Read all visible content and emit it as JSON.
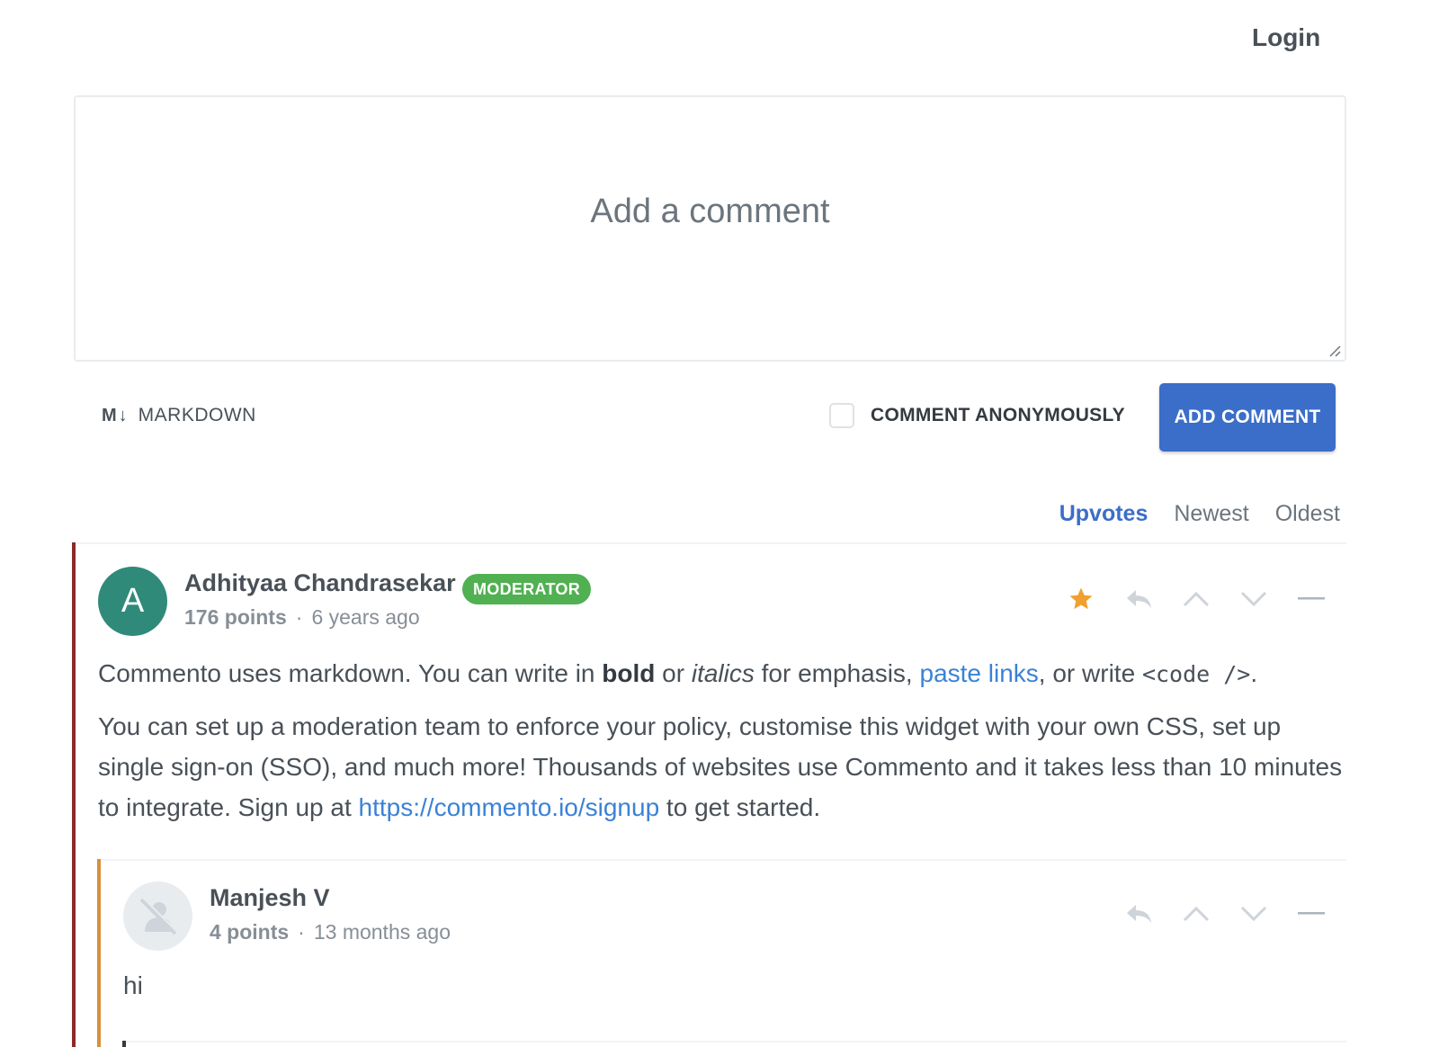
{
  "header": {
    "login_label": "Login"
  },
  "composer": {
    "placeholder": "Add a comment",
    "markdown_icon": "M↓",
    "markdown_label": "MARKDOWN",
    "anonymous_label": "COMMENT ANONYMOUSLY",
    "anonymous_checked": false,
    "submit_label": "ADD COMMENT"
  },
  "sort": {
    "options": [
      "Upvotes",
      "Newest",
      "Oldest"
    ],
    "selected": "Upvotes"
  },
  "colors": {
    "accent": "#3b6ec8",
    "link": "#3b82d6",
    "moderator_badge": "#51b051",
    "star": "#f0a030",
    "thread_bar": "#8c2a2a",
    "reply_bar": "#d6913a",
    "avatar_a": "#2f8a7a"
  },
  "comments": [
    {
      "author": "Adhityaa Chandrasekar",
      "avatar_letter": "A",
      "badge": "MODERATOR",
      "points": "176 points",
      "separator": "·",
      "time": "6 years ago",
      "sticky": true,
      "icons": [
        "star-icon",
        "reply-icon",
        "upvote-icon",
        "downvote-icon",
        "collapse-icon"
      ],
      "body": {
        "p1_a": "Commento uses markdown. You can write in ",
        "p1_bold": "bold",
        "p1_b": " or ",
        "p1_italic": "italics",
        "p1_c": " for emphasis, ",
        "p1_link": "paste links",
        "p1_d": ", or write ",
        "p1_code": "<code />",
        "p1_e": ".",
        "p2_a": "You can set up a moderation team to enforce your policy, customise this widget with your own CSS, set up single sign-on (SSO), and much more! Thousands of websites use Commento and it takes less than 10 minutes to integrate. Sign up at ",
        "p2_link": "https://commento.io/signup",
        "p2_b": " to get started."
      },
      "replies": [
        {
          "author": "Manjesh V",
          "avatar": "anonymous-avatar-icon",
          "points": "4 points",
          "separator": "·",
          "time": "13 months ago",
          "icons": [
            "reply-icon",
            "upvote-icon",
            "downvote-icon",
            "collapse-icon"
          ],
          "body": "hi"
        }
      ]
    }
  ]
}
